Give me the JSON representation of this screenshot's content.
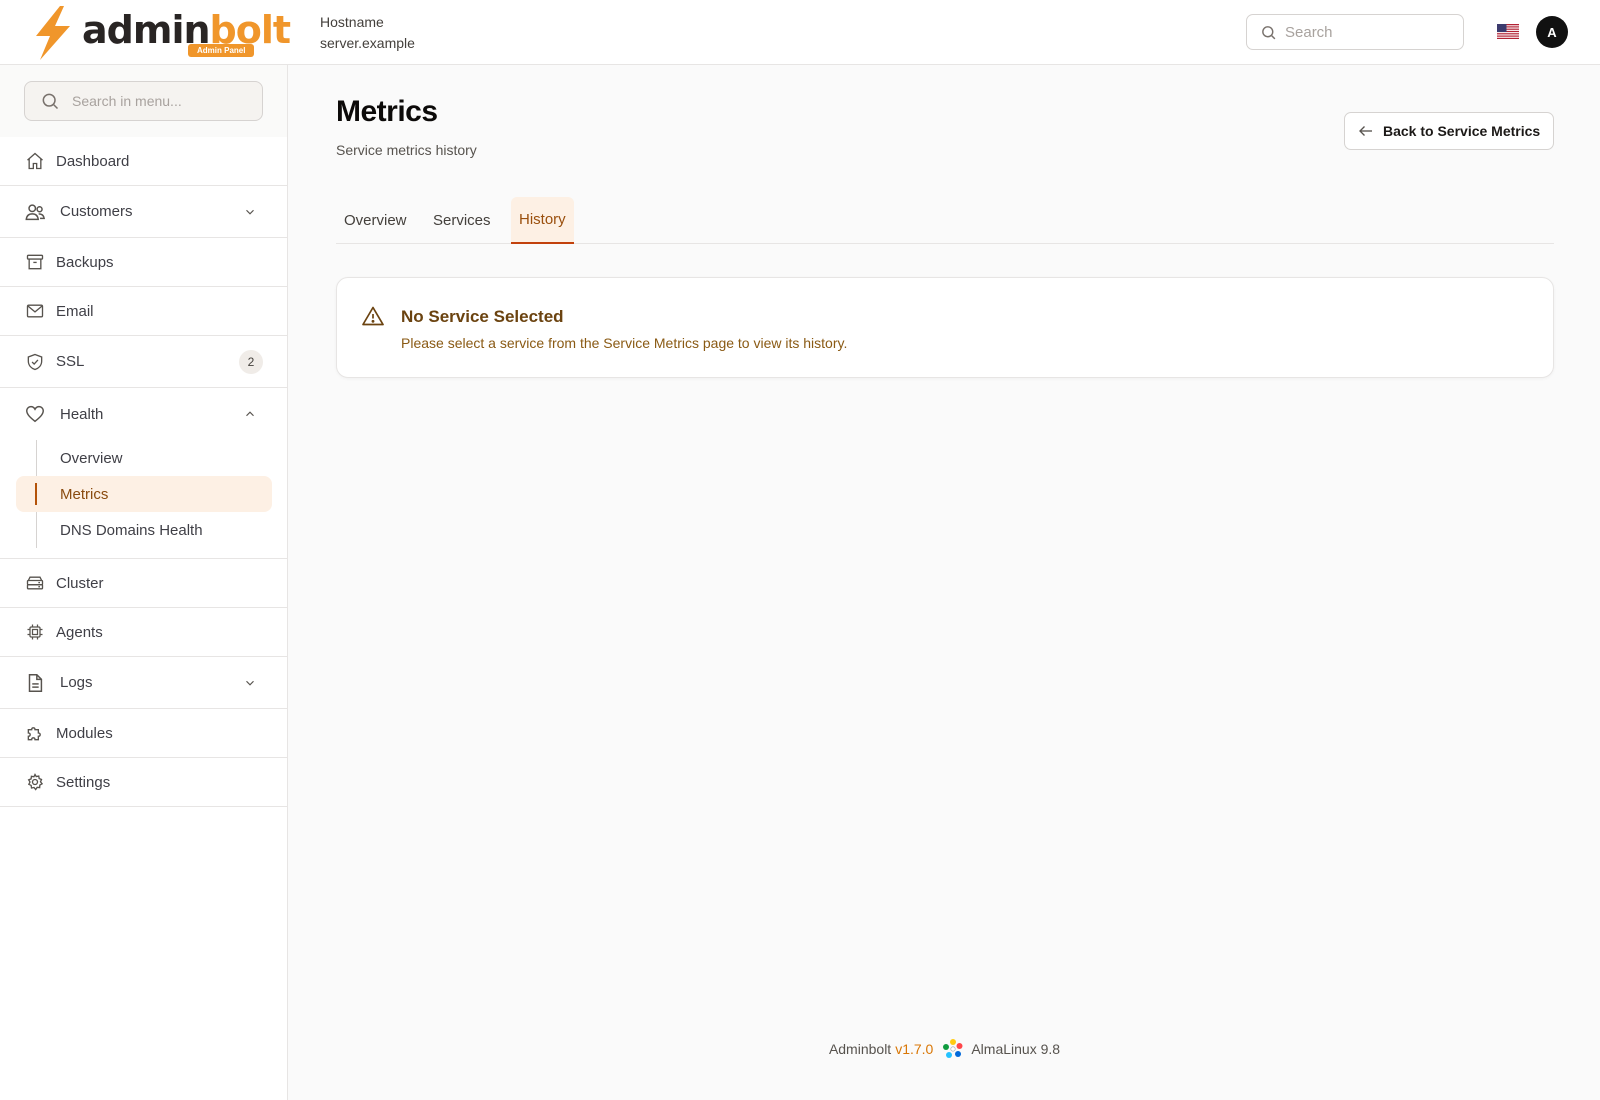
{
  "brand": {
    "name_part1": "admin",
    "name_part2": "bolt",
    "badge": "Admin Panel",
    "accent_color": "#f0962b"
  },
  "header": {
    "hostname_label": "Hostname",
    "hostname_value": "server.example",
    "search_placeholder": "Search",
    "language_icon": "us-flag-icon",
    "avatar_initial": "A"
  },
  "sidebar": {
    "search_placeholder": "Search in menu...",
    "items": [
      {
        "label": "Dashboard",
        "icon": "home-icon"
      },
      {
        "label": "Customers",
        "icon": "users-icon",
        "expandable": true
      },
      {
        "label": "Backups",
        "icon": "archive-icon"
      },
      {
        "label": "Email",
        "icon": "mail-icon"
      },
      {
        "label": "SSL",
        "icon": "shield-check-icon",
        "badge": "2"
      },
      {
        "label": "Health",
        "icon": "heart-icon",
        "expanded": true,
        "children": [
          {
            "label": "Overview"
          },
          {
            "label": "Metrics",
            "active": true
          },
          {
            "label": "DNS Domains Health"
          }
        ]
      },
      {
        "label": "Cluster",
        "icon": "server-stack-icon"
      },
      {
        "label": "Agents",
        "icon": "cpu-chip-icon"
      },
      {
        "label": "Logs",
        "icon": "document-icon",
        "expandable": true
      },
      {
        "label": "Modules",
        "icon": "puzzle-icon"
      },
      {
        "label": "Settings",
        "icon": "cog-icon"
      }
    ]
  },
  "main": {
    "title": "Metrics",
    "subtitle": "Service metrics history",
    "back_button": "Back to Service Metrics",
    "tabs": [
      {
        "label": "Overview"
      },
      {
        "label": "Services"
      },
      {
        "label": "History",
        "active": true
      }
    ],
    "alert": {
      "title": "No Service Selected",
      "message": "Please select a service from the Service Metrics page to view its history.",
      "icon": "warning-triangle-icon"
    }
  },
  "footer": {
    "product": "Adminbolt",
    "version": "v1.7.0",
    "os_icon": "almalinux-icon",
    "os": "AlmaLinux 9.8"
  }
}
